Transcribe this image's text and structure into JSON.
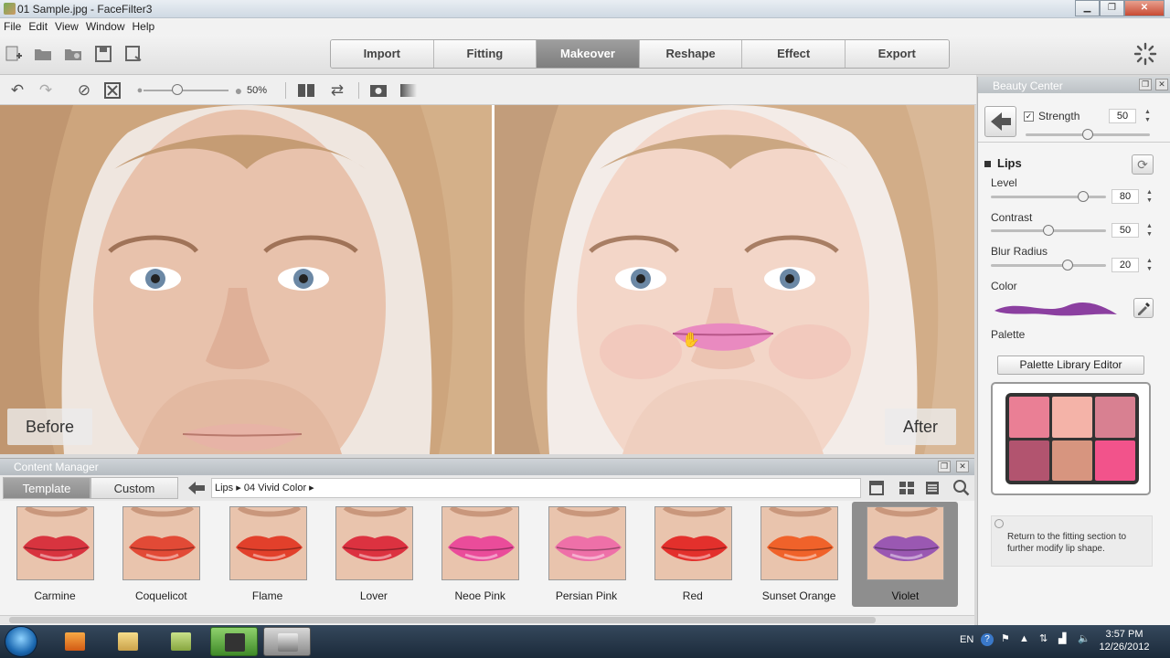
{
  "window": {
    "title": "01 Sample.jpg - FaceFilter3",
    "min_label": "▁",
    "max_label": "❐",
    "close_label": "✕"
  },
  "menu": [
    "File",
    "Edit",
    "View",
    "Window",
    "Help"
  ],
  "workflow_tabs": [
    {
      "label": "Import"
    },
    {
      "label": "Fitting"
    },
    {
      "label": "Makeover",
      "active": true
    },
    {
      "label": "Reshape"
    },
    {
      "label": "Effect"
    },
    {
      "label": "Export"
    }
  ],
  "view_toolbar": {
    "zoom_label": "50%",
    "zoom_fraction": 0.4
  },
  "panes": {
    "before_label": "Before",
    "after_label": "After"
  },
  "content_manager": {
    "title": "Content Manager",
    "tabs": [
      {
        "label": "Template",
        "active": true
      },
      {
        "label": "Custom"
      }
    ],
    "breadcrumb": [
      "Lips",
      "04 Vivid Color"
    ],
    "items": [
      {
        "name": "Carmine",
        "color": "#d8343f"
      },
      {
        "name": "Coquelicot",
        "color": "#e24a36"
      },
      {
        "name": "Flame",
        "color": "#e2402b"
      },
      {
        "name": "Lover",
        "color": "#dc3240"
      },
      {
        "name": "Neoe Pink",
        "color": "#ea4c9a"
      },
      {
        "name": "Persian Pink",
        "color": "#ee70a8"
      },
      {
        "name": "Red",
        "color": "#e3302c"
      },
      {
        "name": "Sunset Orange",
        "color": "#f0622a"
      },
      {
        "name": "Violet",
        "color": "#9a58b2",
        "selected": true
      }
    ]
  },
  "beauty_center": {
    "title": "Beauty Center",
    "strength": {
      "label": "Strength",
      "value": "50",
      "checked": true
    },
    "section": "Lips",
    "level": {
      "label": "Level",
      "value": "80"
    },
    "contrast": {
      "label": "Contrast",
      "value": "50"
    },
    "blur_radius": {
      "label": "Blur Radius",
      "value": "20"
    },
    "color_label": "Color",
    "color": "#8b3fa0",
    "palette_label": "Palette",
    "palette_button": "Palette Library Editor",
    "palette_swatches": [
      "#ea7f95",
      "#f4b3a8",
      "#d88091",
      "#b2546f",
      "#d7957f",
      "#f2538b"
    ],
    "hint": "Return to the fitting section to further modify lip shape."
  },
  "taskbar": {
    "lang": "EN",
    "time": "3:57 PM",
    "date": "12/26/2012"
  },
  "colors": {
    "accent_tab": "#8e8e8e",
    "lip_after": "#e98ac0",
    "lip_before": "#e7b3a6",
    "skin_before": "#e8c2ac",
    "skin_after": "#f3d6c8",
    "hair": "#cda57d"
  }
}
